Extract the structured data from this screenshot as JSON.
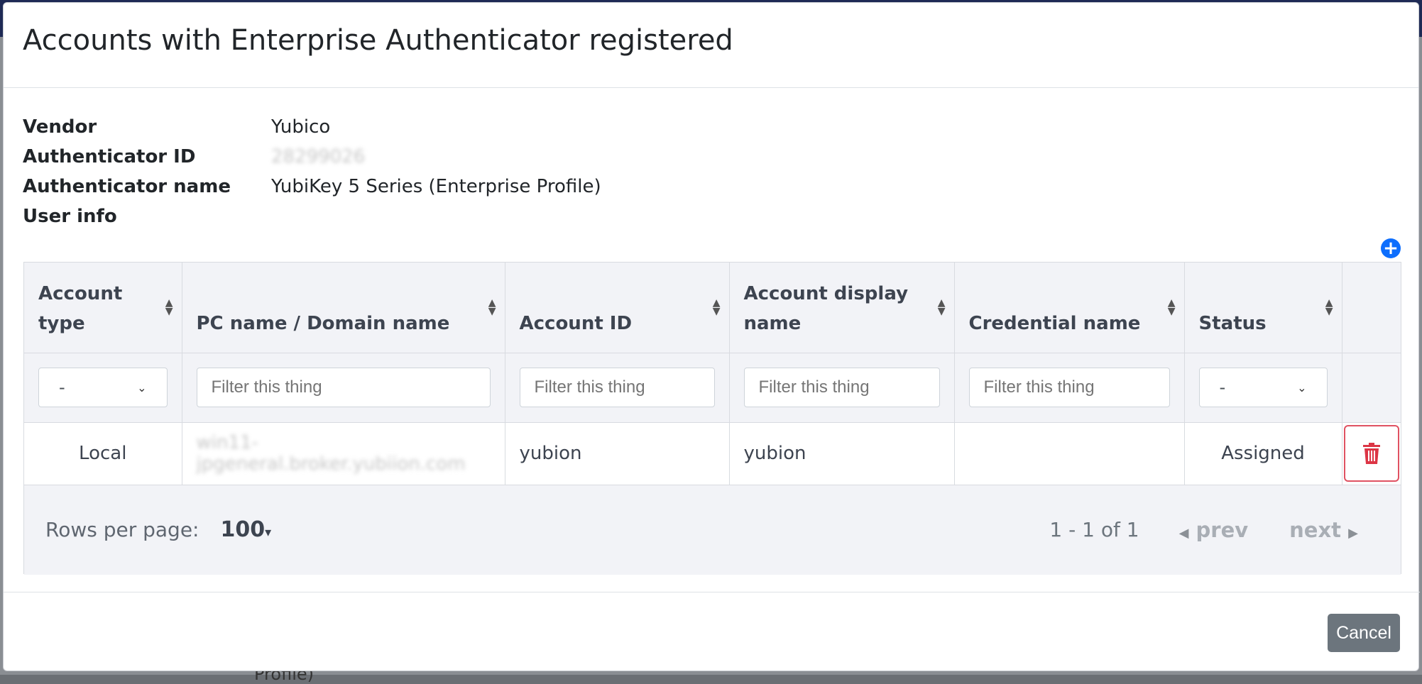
{
  "modal": {
    "title": "Accounts with Enterprise Authenticator registered"
  },
  "info": {
    "rows": [
      {
        "label": "Vendor",
        "value": "Yubico"
      },
      {
        "label": "Authenticator ID",
        "value": "28299026"
      },
      {
        "label": "Authenticator name",
        "value": "YubiKey 5 Series (Enterprise Profile)"
      },
      {
        "label": "User info",
        "value": ""
      }
    ]
  },
  "table": {
    "columns": [
      {
        "label": "Account type"
      },
      {
        "label": "PC name / Domain name"
      },
      {
        "label": "Account ID"
      },
      {
        "label": "Account display name"
      },
      {
        "label": "Credential name"
      },
      {
        "label": "Status"
      }
    ],
    "filters": {
      "account_type_selected": "-",
      "pc_name_placeholder": "Filter this thing",
      "account_id_placeholder": "Filter this thing",
      "display_name_placeholder": "Filter this thing",
      "credential_placeholder": "Filter this thing",
      "status_selected": "-"
    },
    "rows": [
      {
        "account_type": "Local",
        "pc_name": "win11-jpgeneral.broker.yubiion.com",
        "account_id": "yubion",
        "display_name": "yubion",
        "credential_name": "",
        "status": "Assigned"
      }
    ]
  },
  "pager": {
    "rows_per_page_label": "Rows per page:",
    "rows_per_page_value": "100",
    "range": "1 - 1 of 1",
    "prev_label": "prev",
    "next_label": "next"
  },
  "footer": {
    "cancel_label": "Cancel"
  },
  "background": {
    "fragment_text": "Profile)"
  },
  "colors": {
    "accent_blue": "#0d6efd",
    "danger_red": "#dc3545",
    "cancel_gray": "#6c757d",
    "header_bg": "#f2f3f7"
  },
  "icons": {
    "add": "plus-circle-icon",
    "sort": "sort-icon",
    "delete": "trash-icon",
    "dropdown": "chevron-down-icon",
    "prev": "caret-left-icon",
    "next": "caret-right-icon"
  }
}
